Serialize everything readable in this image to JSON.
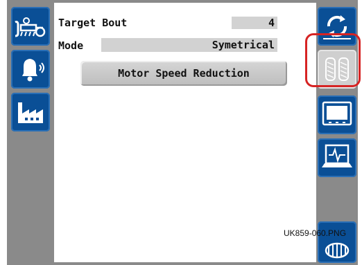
{
  "fields": {
    "target_bout": {
      "label": "Target Bout",
      "value": "4"
    },
    "mode": {
      "label": "Mode",
      "value": "Symetrical"
    }
  },
  "buttons": {
    "motor_speed_reduction": "Motor Speed Reduction"
  },
  "left_softkeys": [
    {
      "icon": "tractor-seeder-icon"
    },
    {
      "icon": "alarm-bell-icon"
    },
    {
      "icon": "factory-icon"
    }
  ],
  "right_softkeys": [
    {
      "icon": "cycle-arrows-icon",
      "enabled": true
    },
    {
      "icon": "tyres-icon",
      "enabled": false,
      "highlighted": true
    },
    {
      "icon": "display-terminal-icon",
      "enabled": true
    },
    {
      "icon": "laptop-diagnostics-icon",
      "enabled": true
    },
    {
      "icon": "roller-icon",
      "enabled": true
    }
  ],
  "image_reference": "UK859-060.PNG",
  "colors": {
    "softkey_blue": "#0a4f96",
    "bar_grey": "#8a8a8a",
    "highlight_red": "#d62323"
  }
}
